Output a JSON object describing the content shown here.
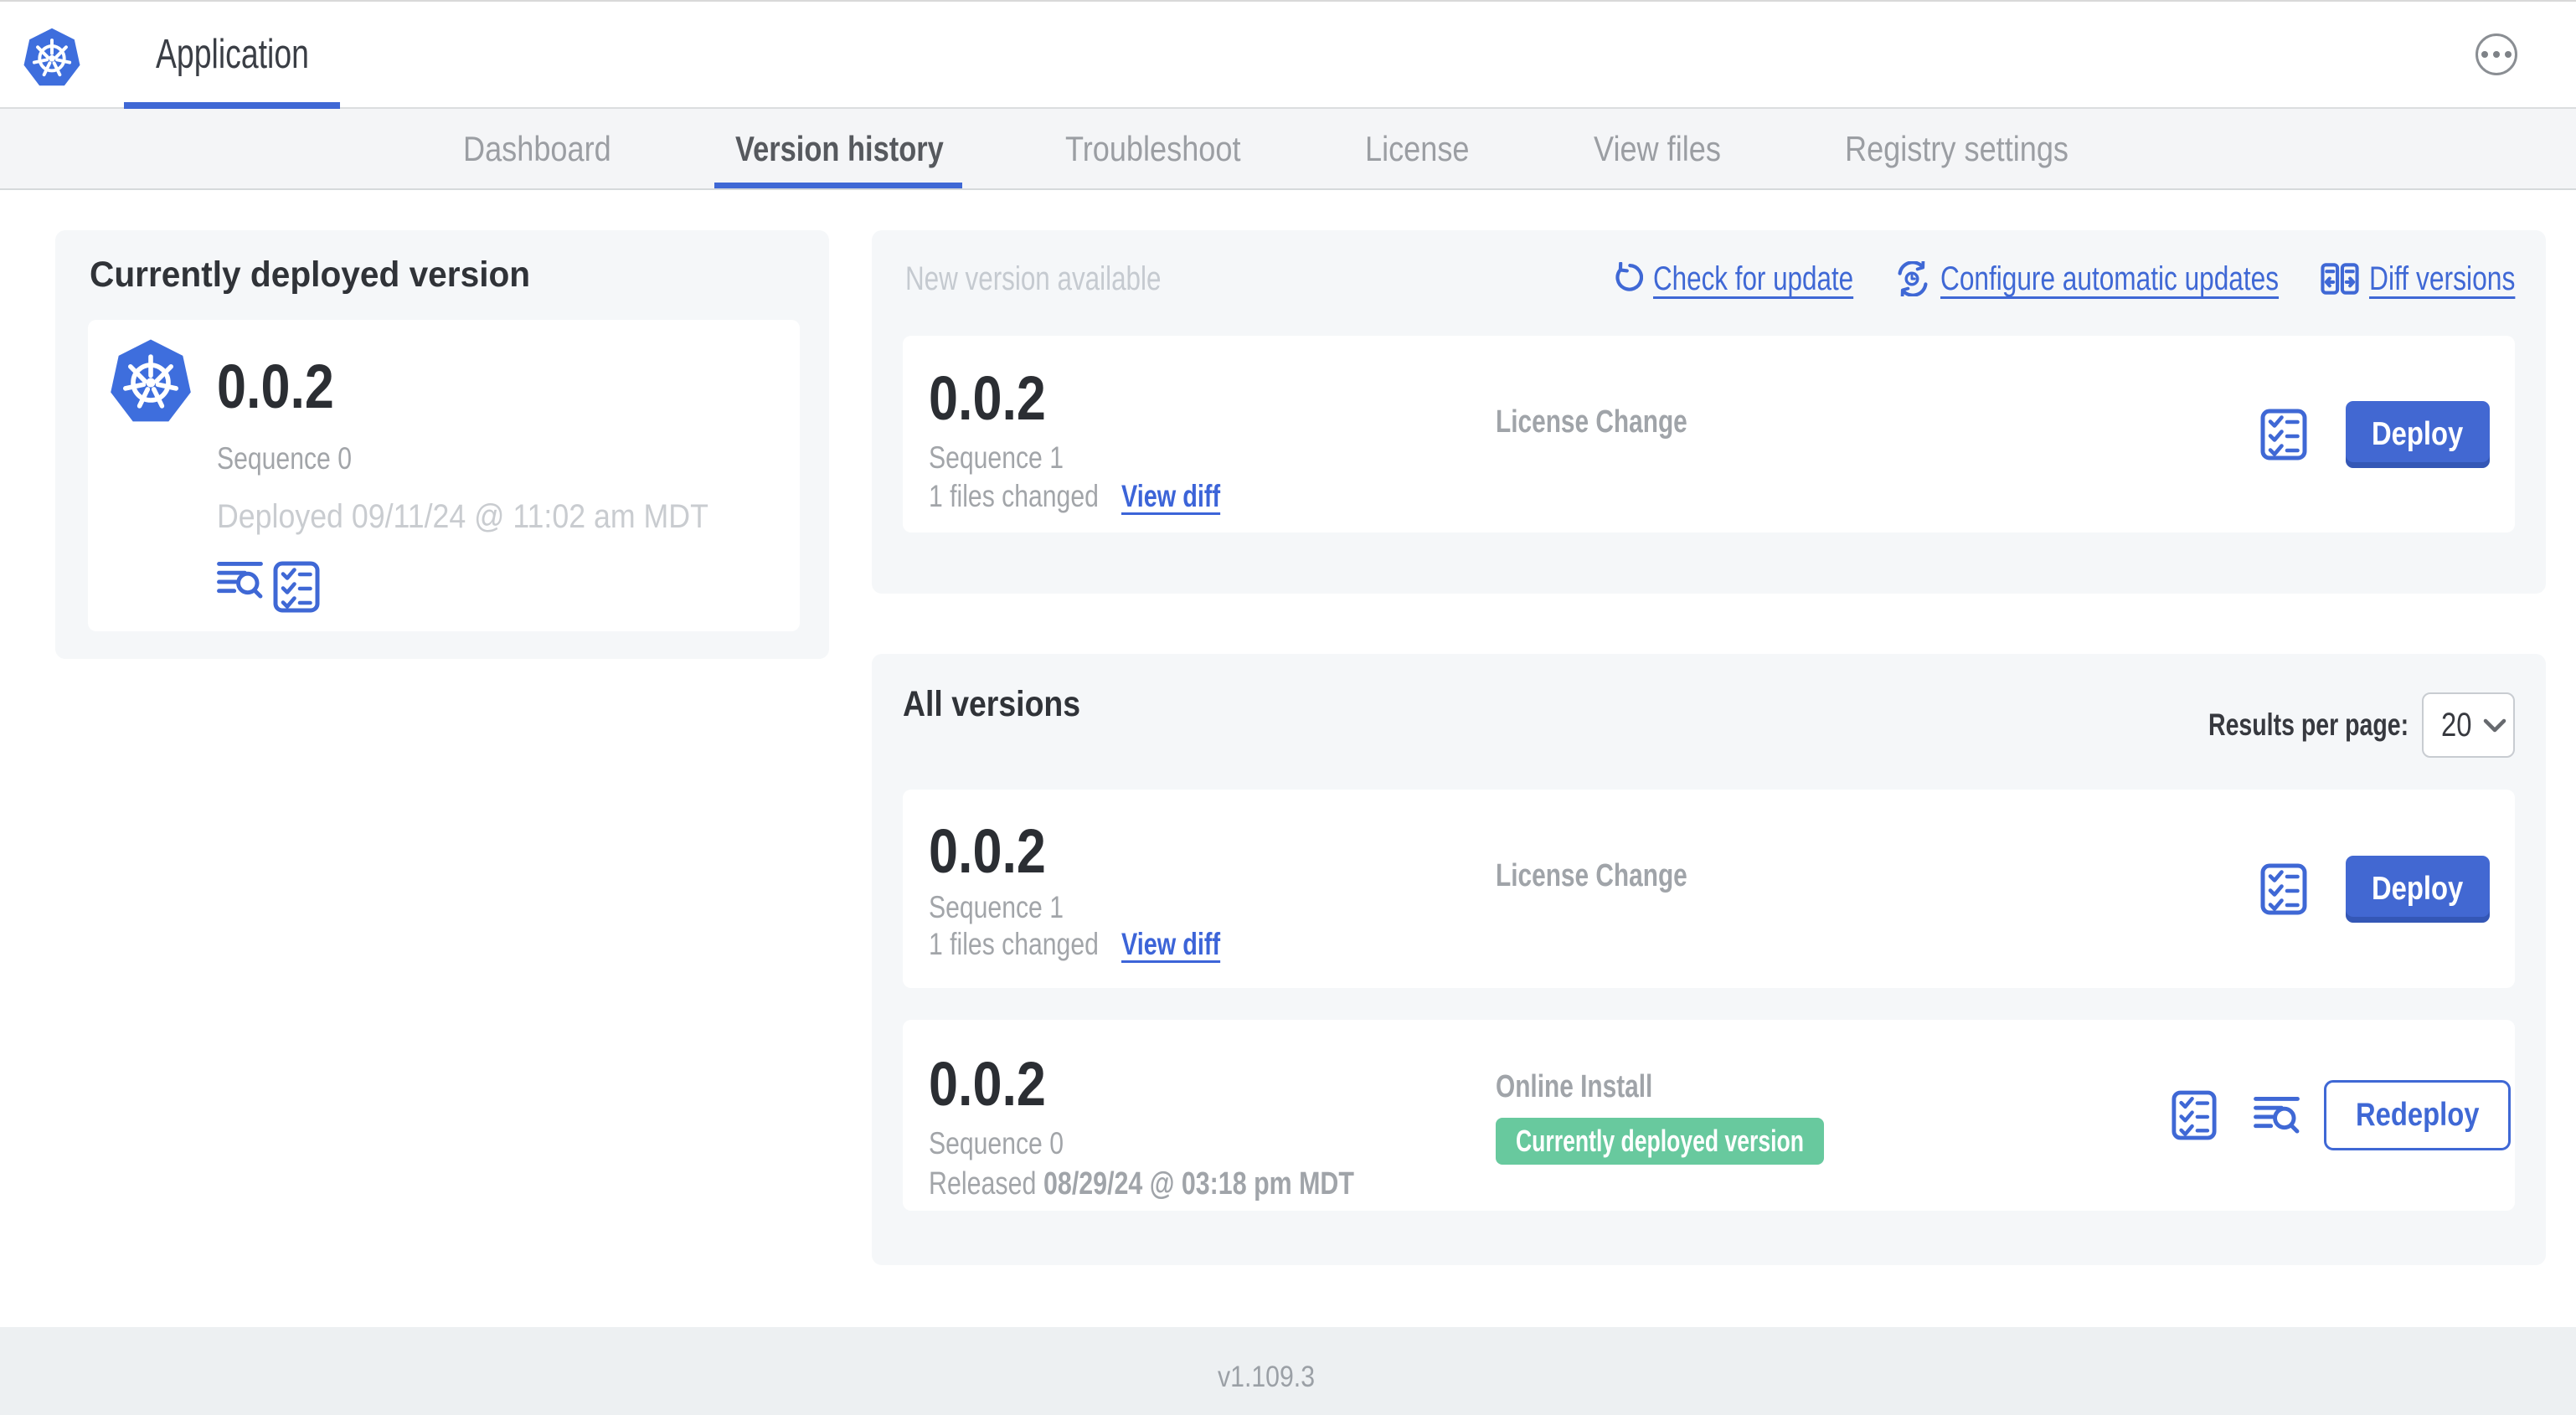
{
  "header": {
    "app_tab_label": "Application",
    "menu_icon": "ellipsis-icon"
  },
  "tabs": [
    {
      "label": "Dashboard",
      "active": false
    },
    {
      "label": "Version history",
      "active": true
    },
    {
      "label": "Troubleshoot",
      "active": false
    },
    {
      "label": "License",
      "active": false
    },
    {
      "label": "View files",
      "active": false
    },
    {
      "label": "Registry settings",
      "active": false
    }
  ],
  "currently_deployed": {
    "title": "Currently deployed version",
    "version": "0.0.2",
    "sequence": "Sequence 0",
    "deployed_at": "Deployed 09/11/24 @ 11:02 am MDT",
    "icons": [
      "release-notes-icon",
      "preflight-checks-icon"
    ]
  },
  "new_version": {
    "title": "New version available",
    "actions": {
      "check_for_update": "Check for update",
      "configure_automatic_updates": "Configure automatic updates",
      "diff_versions": "Diff versions"
    },
    "row": {
      "version": "0.0.2",
      "sequence": "Sequence 1",
      "files_changed": "1 files changed",
      "view_diff": "View diff",
      "source": "License Change",
      "deploy_label": "Deploy"
    }
  },
  "all_versions": {
    "title": "All versions",
    "results_per_page_label": "Results per page:",
    "results_per_page_value": "20",
    "rows": [
      {
        "version": "0.0.2",
        "sequence": "Sequence 1",
        "files_changed": "1 files changed",
        "view_diff": "View diff",
        "source": "License Change",
        "action_label": "Deploy"
      },
      {
        "version": "0.0.2",
        "sequence": "Sequence 0",
        "released_prefix": "Released ",
        "released_date": "08/29/24 @ 03:18 pm MDT",
        "source": "Online Install",
        "badge": "Currently deployed version",
        "action_label": "Redeploy"
      }
    ]
  },
  "footer": {
    "version": "v1.109.3"
  },
  "colors": {
    "accent_blue": "#3f68d5",
    "kubernetes_blue": "#3e6edd",
    "badge_green": "#68c99e",
    "card_gray": "#f5f7f9",
    "subnav_gray": "#f4f5f7",
    "footer_gray": "#edf0f2"
  }
}
